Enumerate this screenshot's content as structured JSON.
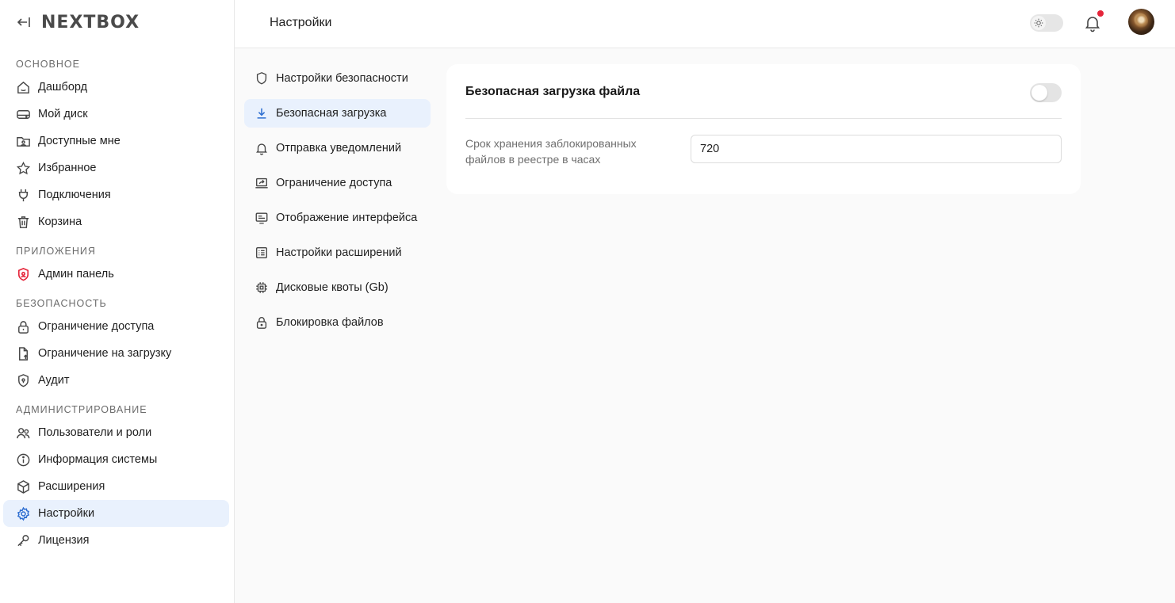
{
  "brand": {
    "logo": "NEXTBOX"
  },
  "header": {
    "title": "Настройки"
  },
  "sidebar": {
    "sections": [
      {
        "title": "Основное",
        "items": [
          {
            "label": "Дашборд",
            "icon": "home-icon"
          },
          {
            "label": "Мой диск",
            "icon": "drive-icon"
          },
          {
            "label": "Доступные мне",
            "icon": "shared-folder-icon"
          },
          {
            "label": "Избранное",
            "icon": "star-icon"
          },
          {
            "label": "Подключения",
            "icon": "plug-icon"
          },
          {
            "label": "Корзина",
            "icon": "trash-icon"
          }
        ]
      },
      {
        "title": "Приложения",
        "items": [
          {
            "label": "Админ панель",
            "icon": "admin-shield-icon"
          }
        ]
      },
      {
        "title": "Безопасность",
        "items": [
          {
            "label": "Ограничение доступа",
            "icon": "lock-icon"
          },
          {
            "label": "Ограничение на загрузку",
            "icon": "file-upload-icon"
          },
          {
            "label": "Аудит",
            "icon": "shield-icon"
          }
        ]
      },
      {
        "title": "Администрирование",
        "items": [
          {
            "label": "Пользователи и роли",
            "icon": "users-icon"
          },
          {
            "label": "Информация системы",
            "icon": "info-icon"
          },
          {
            "label": "Расширения",
            "icon": "cube-icon"
          },
          {
            "label": "Настройки",
            "icon": "gear-icon",
            "active": true
          },
          {
            "label": "Лицензия",
            "icon": "key-icon"
          }
        ]
      }
    ]
  },
  "submenu": [
    {
      "label": "Настройки безопасности",
      "icon": "shield-icon"
    },
    {
      "label": "Безопасная загрузка",
      "icon": "download-icon",
      "active": true
    },
    {
      "label": "Отправка уведомлений",
      "icon": "bell-icon"
    },
    {
      "label": "Ограничение доступа",
      "icon": "laptop-share-icon"
    },
    {
      "label": "Отображение интерфейса",
      "icon": "display-icon"
    },
    {
      "label": "Настройки расширений",
      "icon": "list-icon"
    },
    {
      "label": "Дисковые квоты (Gb)",
      "icon": "chip-icon"
    },
    {
      "label": "Блокировка файлов",
      "icon": "lock-icon"
    }
  ],
  "card": {
    "title": "Безопасная загрузка файла",
    "toggle_on": false,
    "field_label": "Срок хранения заблокированных файлов в реестре в часах",
    "field_value": "720"
  },
  "colors": {
    "accent": "#2f6fd1",
    "active_bg": "#e9f1fd",
    "notification_dot": "#e5253a",
    "admin_icon": "#e5253a"
  }
}
